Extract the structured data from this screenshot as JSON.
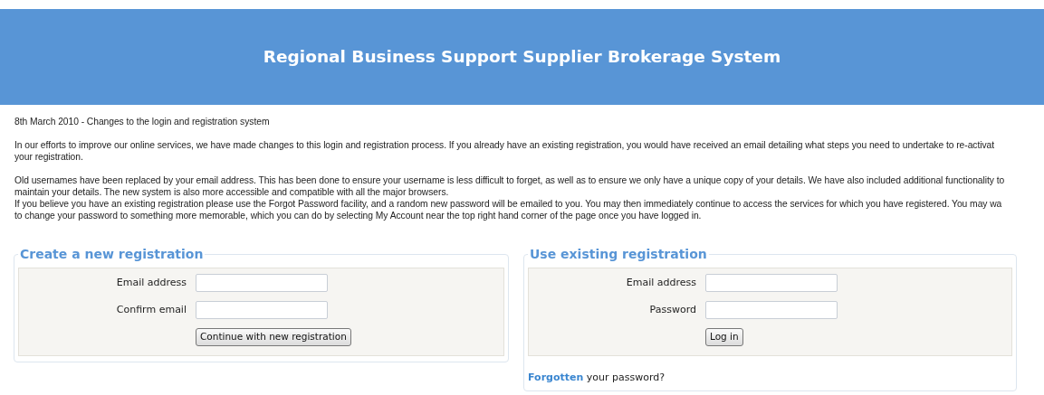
{
  "header": {
    "title": "Regional Business Support Supplier Brokerage System"
  },
  "notice": {
    "heading": "8th March 2010 - Changes to the login and registration system",
    "paragraphs": [
      [
        "In our efforts to improve our online services, we have made changes to this login and registration process. If you already have an existing registration, you would have received an email detailing what steps you need to undertake to re-activat",
        "your registration."
      ],
      [
        "Old usernames have been replaced by your email address. This has been done to ensure your username is less difficult to forget, as well as to ensure we only have a unique copy of your details. We have also included additional functionality to",
        "maintain your details. The new system is also more accessible and compatible with all the major browsers.",
        "If you believe you have an existing registration please use the Forgot Password facility, and a random new password will be emailed to you. You may then immediately continue to access the services for which you have registered. You may wa",
        "to change your password to something more memorable, which you can do by selecting My Account near the top right hand corner of the page once you have logged in."
      ]
    ]
  },
  "panels": [
    {
      "legend": "Create a new registration",
      "fields": [
        {
          "label": "Email address"
        },
        {
          "label": "Confirm email"
        }
      ],
      "button": "Continue with new registration"
    },
    {
      "legend": "Use existing registration",
      "fields": [
        {
          "label": "Email address"
        },
        {
          "label": "Password"
        }
      ],
      "button": "Log in",
      "footer": {
        "link": "Forgotten",
        "text": "your password?"
      }
    }
  ]
}
